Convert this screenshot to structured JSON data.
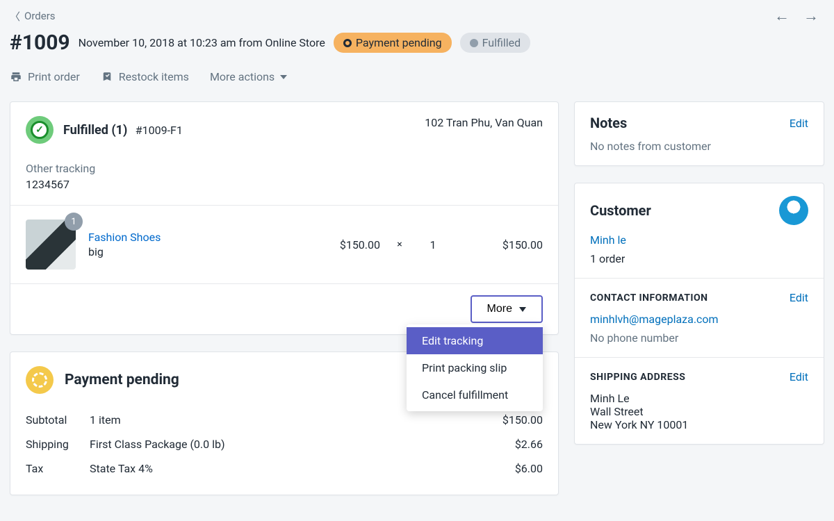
{
  "breadcrumb": "Orders",
  "header": {
    "order_id": "#1009",
    "date_source": "November 10, 2018 at 10:23 am from Online Store",
    "payment_badge": "Payment pending",
    "fulfill_badge": "Fulfilled"
  },
  "toolbar": {
    "print": "Print order",
    "restock": "Restock items",
    "more": "More actions"
  },
  "fulfillment": {
    "title": "Fulfilled (1)",
    "id": "#1009-F1",
    "address": "102 Tran Phu, Van Quan",
    "tracking_label": "Other tracking",
    "tracking_number": "1234567",
    "item": {
      "name": "Fashion Shoes",
      "variant": "big",
      "qty_badge": "1",
      "price": "$150.00",
      "times": "×",
      "qty": "1",
      "total": "$150.00"
    },
    "more_btn": "More",
    "menu": {
      "edit": "Edit tracking",
      "packing": "Print packing slip",
      "cancel": "Cancel fulfillment"
    }
  },
  "payment": {
    "title": "Payment pending",
    "rows": [
      {
        "label": "Subtotal",
        "desc": "1 item",
        "val": "$150.00"
      },
      {
        "label": "Shipping",
        "desc": "First Class Package (0.0 lb)",
        "val": "$2.66"
      },
      {
        "label": "Tax",
        "desc": "State Tax 4%",
        "val": "$6.00"
      }
    ]
  },
  "notes": {
    "title": "Notes",
    "edit": "Edit",
    "body": "No notes from customer"
  },
  "customer": {
    "title": "Customer",
    "name": "Minh le",
    "orders": "1 order",
    "contact_title": "CONTACT INFORMATION",
    "edit": "Edit",
    "email": "minhlvh@mageplaza.com",
    "phone": "No phone number",
    "shipping_title": "SHIPPING ADDRESS",
    "ship_name": "Minh Le",
    "ship_street": "Wall Street",
    "ship_city": "New York NY 10001"
  }
}
